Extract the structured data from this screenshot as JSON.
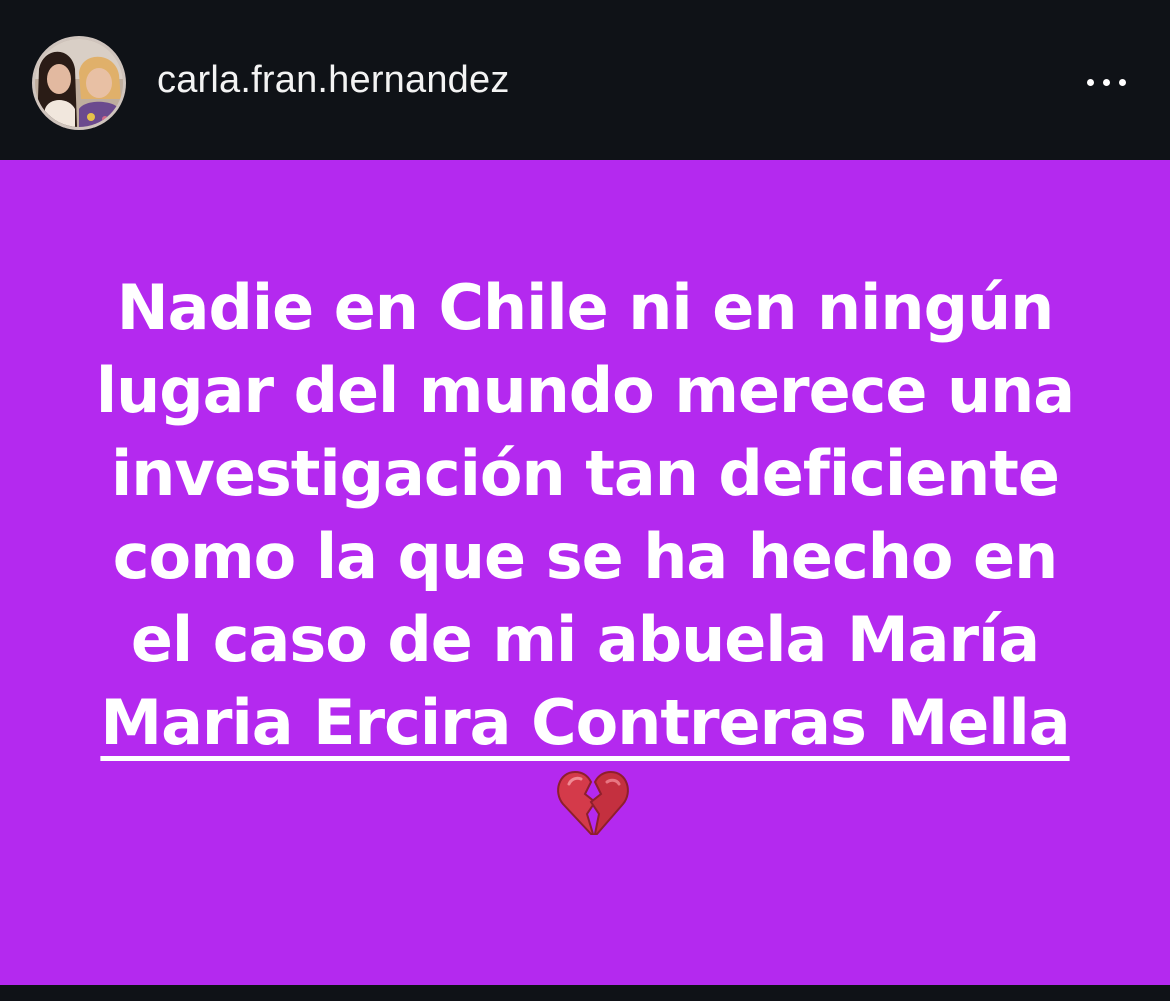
{
  "header": {
    "username": "carla.fran.hernandez",
    "avatar_icon": "profile-photo",
    "more_icon": "more-horizontal-icon"
  },
  "story": {
    "background_color": "#b429ef",
    "text_color": "#ffffff",
    "lines": [
      "Nadie en Chile ni en ningún",
      "lugar del mundo merece una",
      "investigación tan deficiente",
      "como la que se ha hecho en",
      "el caso de mi abuela María"
    ],
    "underlined_line": "Maria Ercira Contreras Mella",
    "emoji_icon": "broken-heart-icon"
  },
  "colors": {
    "header_background": "#0f1217",
    "username_color": "#f3f3f3"
  }
}
